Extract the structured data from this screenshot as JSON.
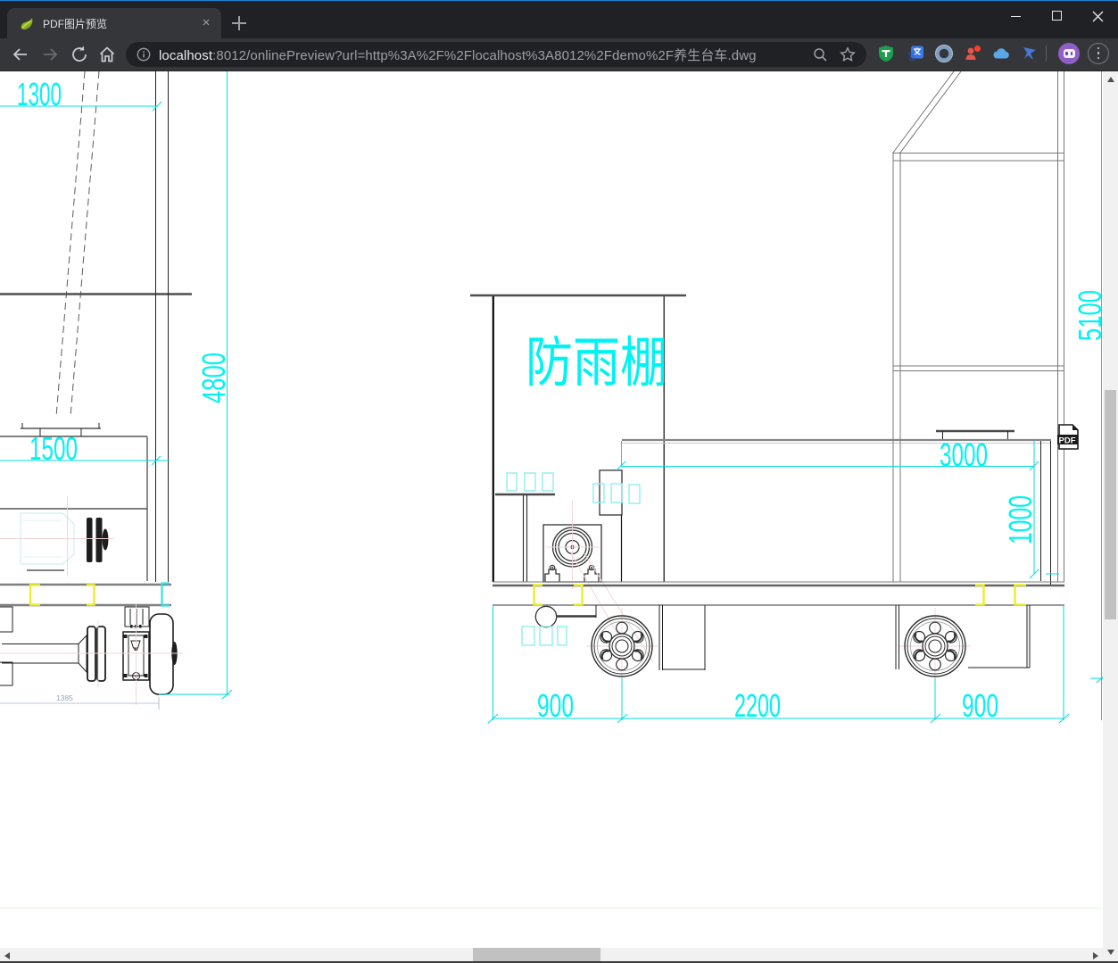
{
  "browser": {
    "tab": {
      "title": "PDF图片预览"
    },
    "url": {
      "host": "localhost",
      "rest": ":8012/onlinePreview?url=http%3A%2F%2Flocalhost%3A8012%2Fdemo%2F养生台车.dwg"
    },
    "extension_icons": [
      "tampermonkey-shield",
      "translate",
      "proxy-ring",
      "fatkun-person",
      "cloud-drive",
      "thunderbird"
    ]
  },
  "drawing": {
    "shelter_label": "防雨棚",
    "pdf_badge": "PDF",
    "dims": {
      "d1300": "1300",
      "d4800": "4800",
      "d1500": "1500",
      "d1385": "1385",
      "d5100": "5100",
      "d3000": "3000",
      "d1000": "1000",
      "d900_left": "900",
      "d2200": "2200",
      "d900_right": "900"
    }
  }
}
